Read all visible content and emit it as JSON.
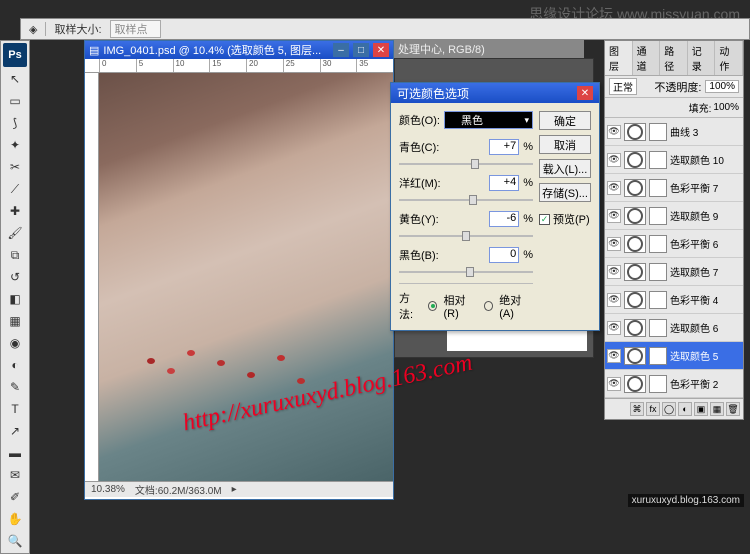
{
  "watermark_top": "思缘设计论坛  www.missyuan.com",
  "options_bar": {
    "sample_label": "取样大小:",
    "sample_value": "取样点"
  },
  "doc": {
    "title": "IMG_0401.psd @ 10.4% (选取颜色 5, 图层...",
    "bg_title": "处理中心, RGB/8)",
    "zoom": "10.38%",
    "file_info": "文档:60.2M/363.0M",
    "ruler": [
      "0",
      "5",
      "10",
      "15",
      "20",
      "25",
      "30",
      "35"
    ]
  },
  "dialog": {
    "title": "可选颜色选项",
    "color_label": "颜色(O):",
    "color_value": "黑色",
    "rows": [
      {
        "label": "青色(C):",
        "value": "+7",
        "pct": "%"
      },
      {
        "label": "洋红(M):",
        "value": "+4",
        "pct": "%"
      },
      {
        "label": "黄色(Y):",
        "value": "-6",
        "pct": "%"
      },
      {
        "label": "黑色(B):",
        "value": "0",
        "pct": "%"
      }
    ],
    "method_label": "方法:",
    "method_relative": "相对(R)",
    "method_absolute": "绝对(A)",
    "buttons": {
      "ok": "确定",
      "cancel": "取消",
      "load": "载入(L)...",
      "save": "存储(S)..."
    },
    "preview": "预览(P)"
  },
  "layers": {
    "tabs": [
      "图层",
      "通道",
      "路径",
      "记录",
      "动作"
    ],
    "mode": "正常",
    "opacity_label": "不透明度:",
    "opacity": "100%",
    "fill_label": "填充:",
    "fill": "100%",
    "items": [
      {
        "name": "曲线 3"
      },
      {
        "name": "选取颜色 10"
      },
      {
        "name": "色彩平衡 7"
      },
      {
        "name": "选取颜色 9"
      },
      {
        "name": "色彩平衡 6"
      },
      {
        "name": "选取颜色 7"
      },
      {
        "name": "色彩平衡 4"
      },
      {
        "name": "选取颜色 6"
      },
      {
        "name": "选取颜色 5",
        "selected": true
      },
      {
        "name": "色彩平衡 2"
      }
    ]
  },
  "url_watermark": "http://xuruxuxyd.blog.163.com",
  "url_watermark2": "xuruxuxyd.blog.163.com"
}
